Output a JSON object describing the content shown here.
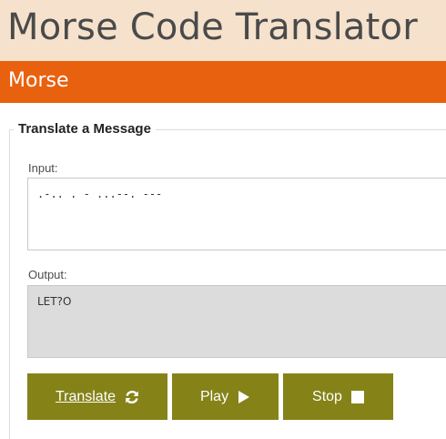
{
  "header": {
    "title": "Morse Code Translator"
  },
  "subbar": {
    "label": "Morse"
  },
  "form": {
    "legend": "Translate a Message",
    "input_label": "Input:",
    "input_value": ".-.. . - ...--. ---",
    "output_label": "Output:",
    "output_value": "LET?O"
  },
  "buttons": {
    "translate": {
      "label": "Translate",
      "icon": "refresh-icon"
    },
    "play": {
      "label": "Play",
      "icon": "play-icon"
    },
    "stop": {
      "label": "Stop",
      "icon": "stop-icon"
    }
  },
  "colors": {
    "header_bg": "#f5e1cc",
    "accent_orange": "#e8610f",
    "button_olive": "#858218",
    "output_bg": "#dcdcdc"
  }
}
